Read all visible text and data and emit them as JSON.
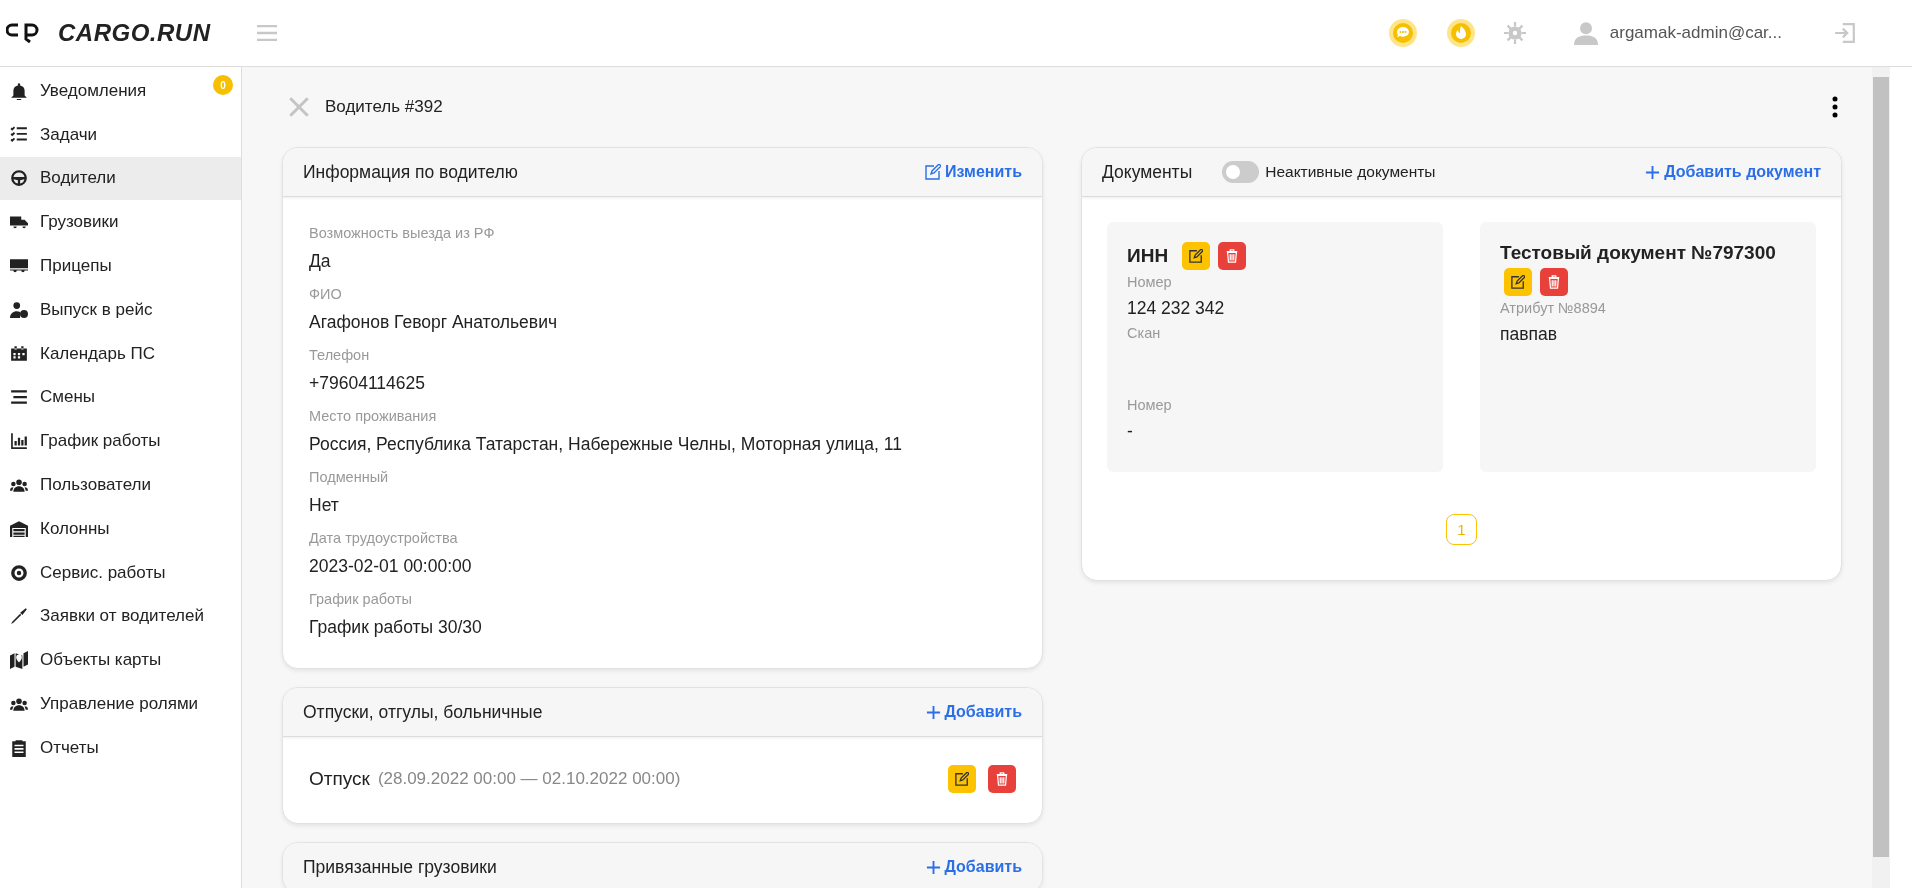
{
  "header": {
    "logo": "CARGO.RUN",
    "user": "argamak-admin@car..."
  },
  "sidebar": {
    "items": [
      {
        "label": "Уведомления",
        "selected": false,
        "badge": "0"
      },
      {
        "label": "Задачи",
        "selected": false
      },
      {
        "label": "Водители",
        "selected": true
      },
      {
        "label": "Грузовики",
        "selected": false
      },
      {
        "label": "Прицепы",
        "selected": false
      },
      {
        "label": "Выпуск в рейс",
        "selected": false
      },
      {
        "label": "Календарь ПС",
        "selected": false
      },
      {
        "label": "Смены",
        "selected": false
      },
      {
        "label": "График работы",
        "selected": false
      },
      {
        "label": "Пользователи",
        "selected": false
      },
      {
        "label": "Колонны",
        "selected": false
      },
      {
        "label": "Сервис. работы",
        "selected": false
      },
      {
        "label": "Заявки от водителей",
        "selected": false
      },
      {
        "label": "Объекты карты",
        "selected": false
      },
      {
        "label": "Управление ролями",
        "selected": false
      },
      {
        "label": "Отчеты",
        "selected": false
      }
    ]
  },
  "page": {
    "title": "Водитель #392"
  },
  "driver_info": {
    "title": "Информация по водителю",
    "action": "Изменить",
    "fields": [
      {
        "label": "Возможность выезда из РФ",
        "value": "Да"
      },
      {
        "label": "ФИО",
        "value": "Агафонов Геворг Анатольевич"
      },
      {
        "label": "Телефон",
        "value": "+79604114625"
      },
      {
        "label": "Место проживания",
        "value": "Россия, Республика Татарстан, Набережные Челны, Моторная улица, 11"
      },
      {
        "label": "Подменный",
        "value": "Нет"
      },
      {
        "label": "Дата трудоустройства",
        "value": "2023-02-01 00:00:00"
      },
      {
        "label": "График работы",
        "value": "График работы 30/30"
      }
    ]
  },
  "absences": {
    "title": "Отпуски, отгулы, больничные",
    "action": "Добавить",
    "items": [
      {
        "type": "Отпуск",
        "period": "(28.09.2022 00:00 — 02.10.2022 00:00)"
      }
    ]
  },
  "trucks": {
    "title": "Привязанные грузовики",
    "action": "Добавить"
  },
  "documents": {
    "title": "Документы",
    "toggle": {
      "label": "Неактивные документы",
      "on": false
    },
    "action": "Добавить документ",
    "cards": [
      {
        "title": "ИНН",
        "fields": [
          {
            "label": "Номер",
            "value": "124 232 342"
          },
          {
            "label": "Скан"
          },
          {
            "label": "Номер",
            "value": "-"
          }
        ]
      },
      {
        "title": "Тестовый документ №797300",
        "fields": [
          {
            "label": "Атрибут №8894",
            "value": "павпав"
          }
        ]
      }
    ],
    "pages": [
      {
        "label": "1",
        "selected": true
      }
    ]
  }
}
